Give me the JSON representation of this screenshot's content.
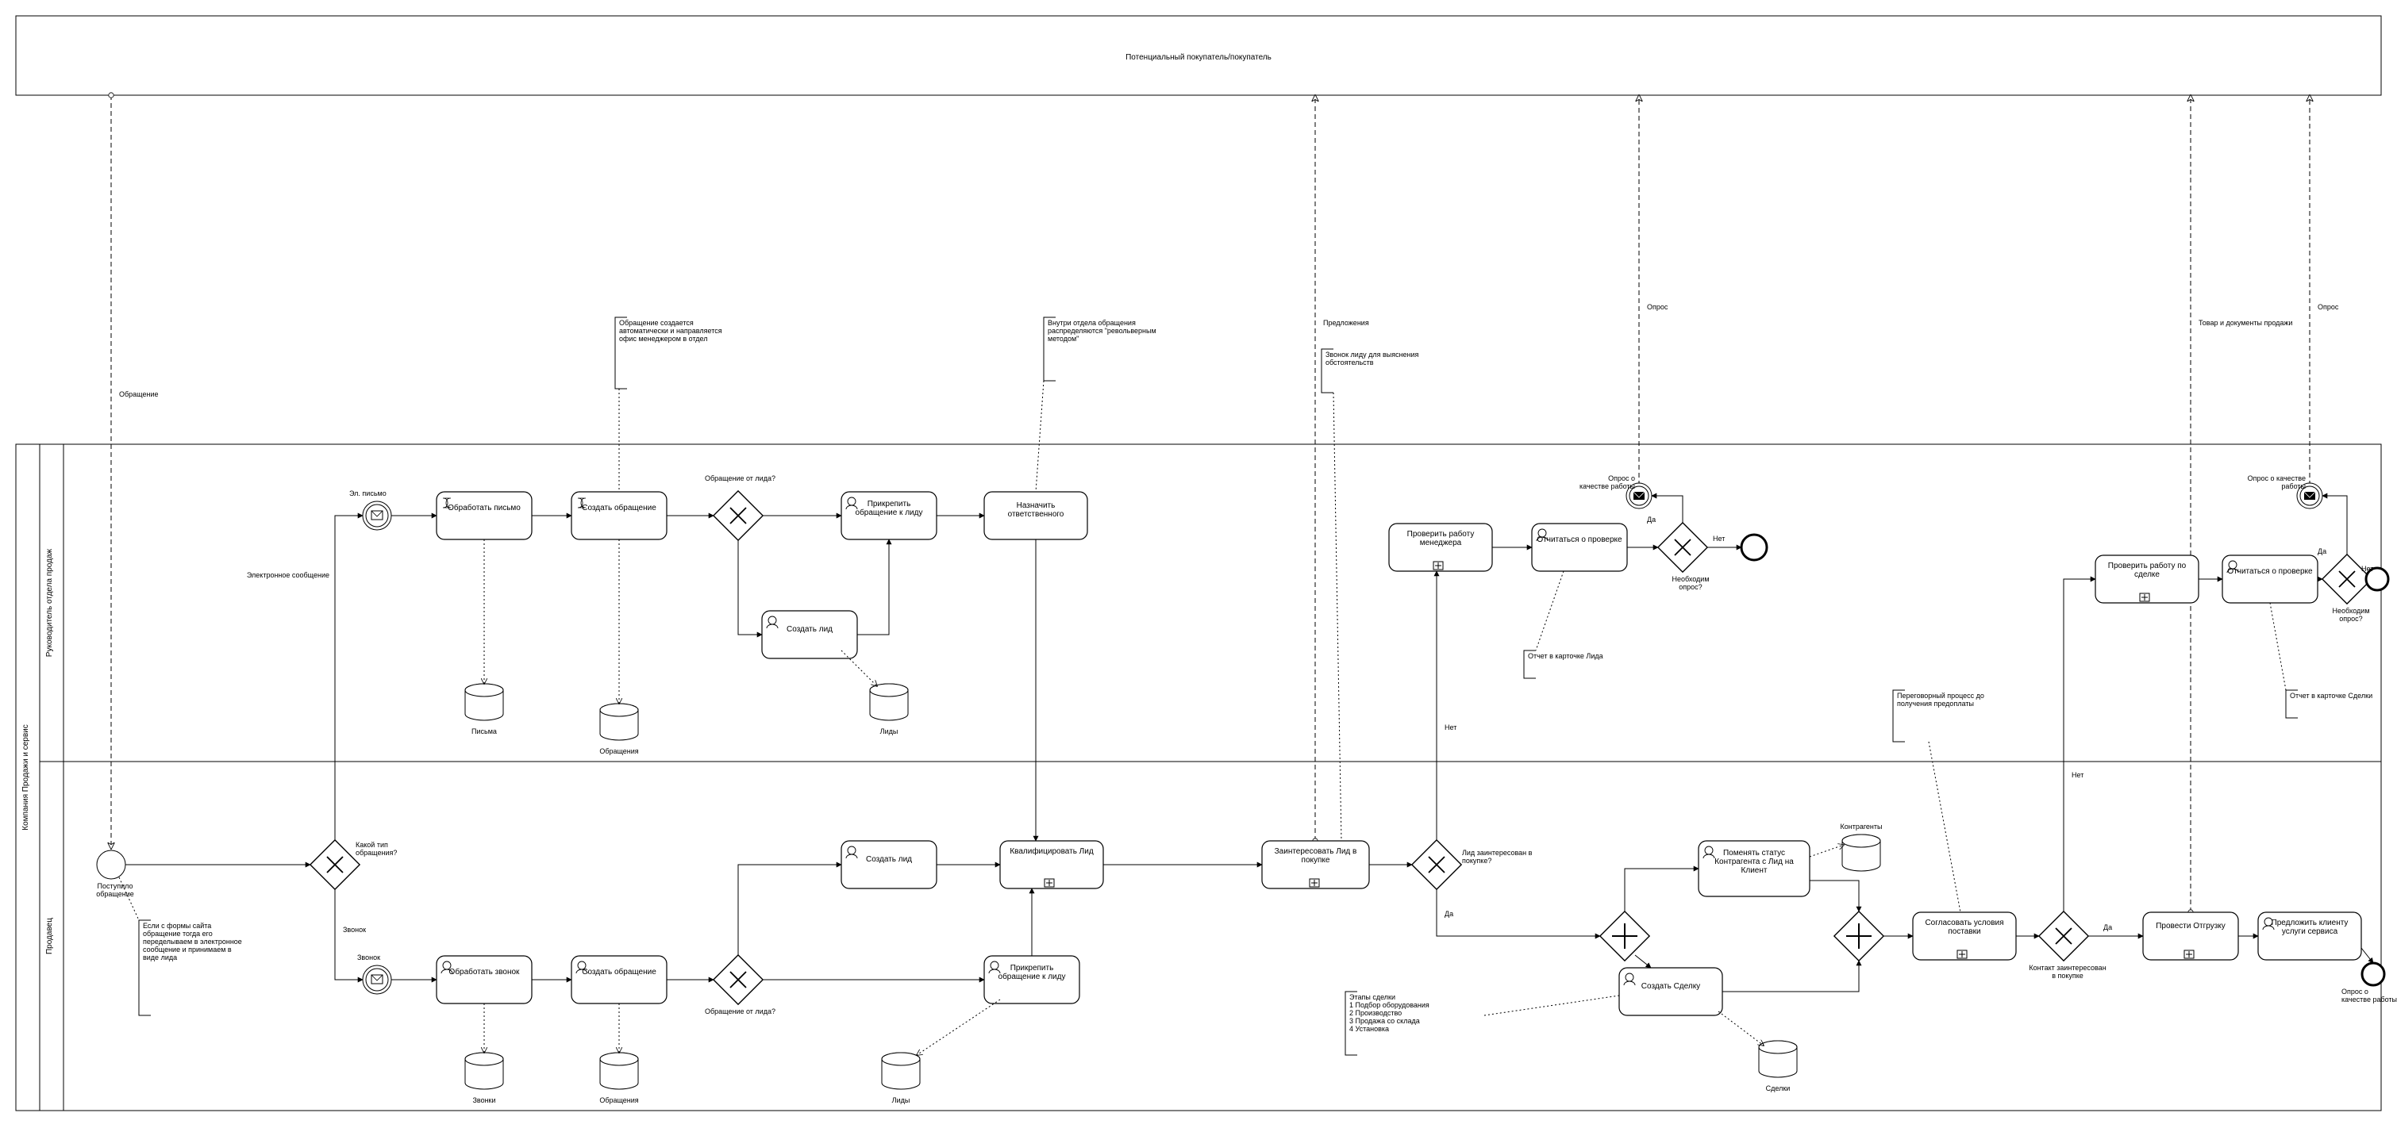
{
  "pools": {
    "buyer": {
      "title": "Потенциальный покупатель/покупатель"
    },
    "company": {
      "title": "Компания Продажи и сервис",
      "lanes": {
        "manager": {
          "title": "Руководитель отдела продаж"
        },
        "seller": {
          "title": "Продавец"
        }
      }
    }
  },
  "events": {
    "startRequest": {
      "label": "Поступило обращение"
    },
    "emailEvent": {
      "label": "Эл. письмо"
    },
    "callEvent": {
      "label": "Звонок"
    },
    "endPlain1": {
      "label": ""
    },
    "survey1": {
      "label": "Опрос о качестве работы"
    },
    "survey2": {
      "label": "Опрос о качестве работы"
    },
    "endPlain2": {
      "label": ""
    },
    "endSurvey": {
      "label": "Опрос о качестве работы"
    }
  },
  "gateways": {
    "gwType": {
      "label": "Какой тип обращения?"
    },
    "gwFromLead1": {
      "label": "Обращение от лида?"
    },
    "gwFromLead2": {
      "label": "Обращение от лида?"
    },
    "gwLeadInterested": {
      "label": "Лид заинтересован в покупке?"
    },
    "gwNeedSurvey1": {
      "label": "Необходим опрос?"
    },
    "gwSplit": {
      "label": ""
    },
    "gwJoin": {
      "label": ""
    },
    "gwContractInterested": {
      "label": "Контакт заинтересован в покупке"
    },
    "gwNeedSurvey2": {
      "label": "Необходим опрос?"
    }
  },
  "tasks": {
    "processEmail": {
      "label": "Обработать письмо"
    },
    "createRequest1": {
      "label": "Создать обращение"
    },
    "attachToLead1": {
      "label": "Прикрепить обращение к лиду"
    },
    "assignResp": {
      "label": "Назначить ответственного"
    },
    "createLeadTop": {
      "label": "Создать лид"
    },
    "processCall": {
      "label": "Обработать звонок"
    },
    "createRequest2": {
      "label": "Создать обращение"
    },
    "createLeadBot": {
      "label": "Создать лид"
    },
    "attachToLead2": {
      "label": "Прикрепить обращение к лиду"
    },
    "qualifyLead": {
      "label": "Квалифицировать Лид"
    },
    "interestLead": {
      "label": "Заинтересовать Лид в покупке"
    },
    "checkMgrWork": {
      "label": "Проверить работу менеджера"
    },
    "reportCheck1": {
      "label": "Отчитаться о проверке"
    },
    "changeStatus": {
      "label": "Поменять статус Контрагента с Лид на Клиент"
    },
    "createDeal": {
      "label": "Создать Сделку"
    },
    "agreeDelivery": {
      "label": "Согласовать условия поставки"
    },
    "doShipment": {
      "label": "Провести Отгрузку"
    },
    "offerService": {
      "label": "Предложить клиенту услуги сервиса"
    },
    "checkDealWork": {
      "label": "Проверить работу по сделке"
    },
    "reportCheck2": {
      "label": "Отчитаться о проверке"
    }
  },
  "dataStores": {
    "emails": {
      "label": "Письма"
    },
    "requests1": {
      "label": "Обращения"
    },
    "leads1": {
      "label": "Лиды"
    },
    "calls": {
      "label": "Звонки"
    },
    "requests2": {
      "label": "Обращения"
    },
    "leads2": {
      "label": "Лиды"
    },
    "contragents": {
      "label": "Контрагенты"
    },
    "deals": {
      "label": "Сделки"
    }
  },
  "annotations": {
    "formNote": {
      "text": "Если с формы сайта обращение тогда его переделываем в электронное сообщение и принимаем в виде лида"
    },
    "autoRequest": {
      "text": "Обращение создается автоматически и направляется офис менеджером в отдел"
    },
    "revolver": {
      "text": "Внутри отдела обращения распределяются \"револьверным методом\""
    },
    "callLead": {
      "text": "Звонок лиду для выяснения обстоятельств"
    },
    "reportCard1": {
      "text": "Отчет в карточке Лида"
    },
    "dealStages": {
      "text": "Этапы сделки\n1 Подбор оборудования\n2 Производство\n3 Продажа со склада\n4 Установка"
    },
    "negotiation": {
      "text": "Переговорный процесс до получения предоплаты"
    },
    "reportCard2": {
      "text": "Отчет в карточке Сделки"
    }
  },
  "flowLabels": {
    "request": "Обращение",
    "emailMsg": "Электронное сообщение",
    "call": "Звонок",
    "offers": "Предложения",
    "survey": "Опрос",
    "goodsDocs": "Товар и документы продажи",
    "yes": "Да",
    "no": "Нет"
  }
}
